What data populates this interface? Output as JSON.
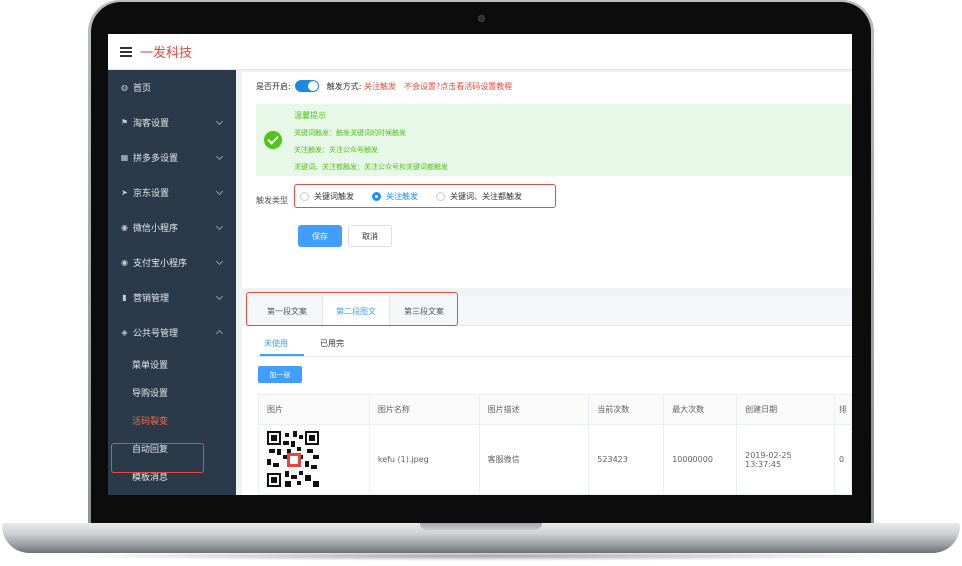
{
  "header": {
    "brand": "一发科技"
  },
  "sidebar": {
    "items": [
      {
        "label": "首页",
        "icon": "dashboard-icon",
        "glyph": "◍"
      },
      {
        "label": "淘客设置",
        "icon": "tao-icon",
        "glyph": "⚑"
      },
      {
        "label": "拼多多设置",
        "icon": "grid-icon",
        "glyph": "▦"
      },
      {
        "label": "京东设置",
        "icon": "send-icon",
        "glyph": "➤"
      },
      {
        "label": "微信小程序",
        "icon": "wechat-icon",
        "glyph": "◉"
      },
      {
        "label": "支付宝小程序",
        "icon": "alipay-icon",
        "glyph": "◉"
      },
      {
        "label": "营销管理",
        "icon": "chart-icon",
        "glyph": "▮"
      },
      {
        "label": "公共号管理",
        "icon": "users-icon",
        "glyph": "◈"
      }
    ],
    "sub_items": [
      "菜单设置",
      "导购设置",
      "活码裂变",
      "自动回复",
      "模板消息"
    ]
  },
  "settings": {
    "enable_label": "是否开启:",
    "mode_label": "触发方式:",
    "mode_value": "关注触发",
    "tutorial_link": "不会设置?点击看活码设置教程",
    "tip": {
      "title": "温馨提示",
      "lines": [
        "关键词触发：触发关键词的时候触发",
        "关注触发：关注公众号触发",
        "关键词、关注都触发：关注公众号和关键词都触发"
      ]
    },
    "trigger_type_label": "触发类型",
    "trigger_options": [
      "关键词触发",
      "关注触发",
      "关键词、关注都触发"
    ],
    "selected_option": "关注触发",
    "save_label": "保存",
    "cancel_label": "取消"
  },
  "content_tabs": [
    "第一段文案",
    "第二段图文",
    "第三段文案"
  ],
  "status_tabs": [
    "未使用",
    "已用完"
  ],
  "add_label": "加一张",
  "table": {
    "columns": [
      "图片",
      "图片名称",
      "图片描述",
      "当前次数",
      "最大次数",
      "创建日期",
      "排"
    ],
    "rows": [
      {
        "name": "kefu (1).jpeg",
        "desc": "客服微信",
        "current": "523423",
        "max": "10000000",
        "date": "2019-02-25 13:37:45",
        "order": "0"
      }
    ]
  },
  "colors": {
    "accent": "#409eff",
    "brand": "#e8453c",
    "sidebar": "#2b3a4a",
    "highlight": "#e74c3c",
    "tip": "#52c41a"
  }
}
